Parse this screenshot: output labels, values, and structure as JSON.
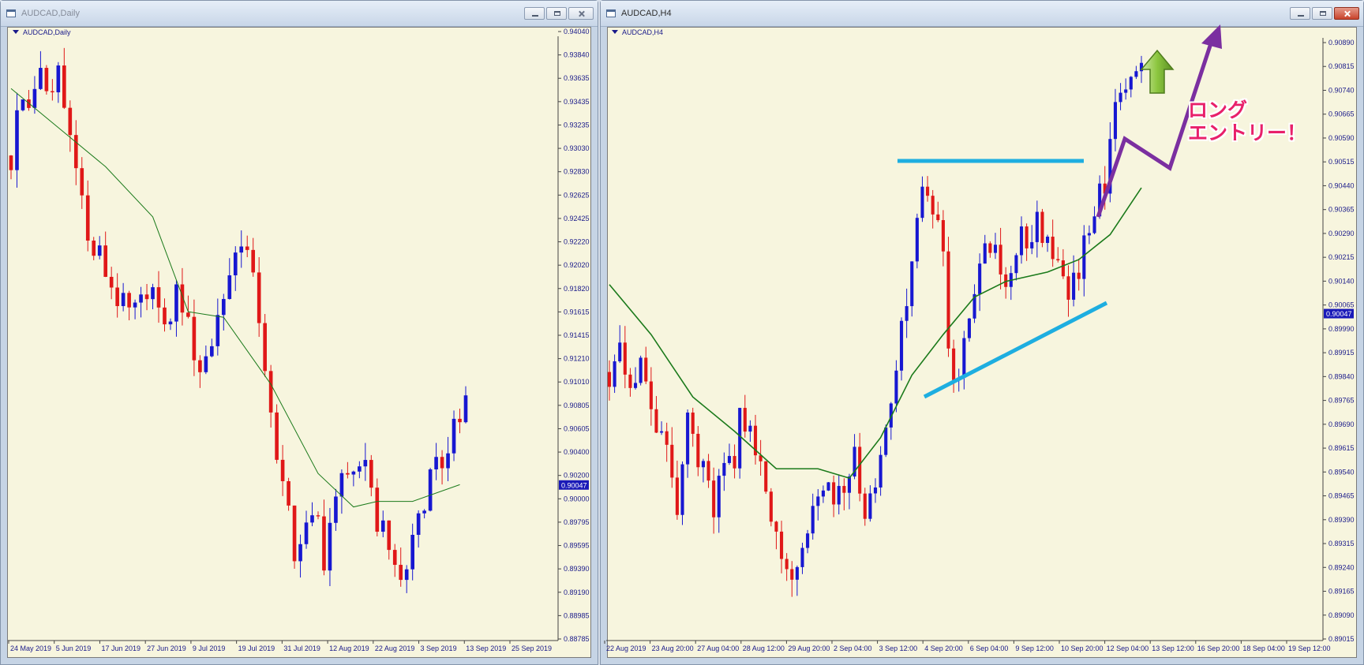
{
  "windows": [
    {
      "id": "left",
      "title": "AUDCAD,Daily",
      "chart_label": "AUDCAD,Daily",
      "active": false
    },
    {
      "id": "right",
      "title": "AUDCAD,H4",
      "chart_label": "AUDCAD,H4",
      "active": true
    }
  ],
  "annotation": {
    "line1": "ロング",
    "line2": "エントリー！"
  },
  "colors": {
    "bull": "#1717d1",
    "bear": "#e01818",
    "ma": "#1b7a1b",
    "trendline": "#1eaee0",
    "arrow": "#7b2fa0",
    "price_tag": "#1a1ab8"
  },
  "icons": {
    "window": "chart-window-icon",
    "minimize": "minimize-icon",
    "maximize": "maximize-icon",
    "close": "close-icon",
    "up": "green-up-arrow-icon"
  },
  "chart_data": [
    {
      "type": "candlestick",
      "symbol": "AUDCAD",
      "timeframe": "Daily",
      "ylim": [
        0.8878,
        0.9404
      ],
      "y_ticks": [
        "0.94040",
        "0.93840",
        "0.93635",
        "0.93435",
        "0.93235",
        "0.93030",
        "0.92830",
        "0.92625",
        "0.92425",
        "0.92220",
        "0.92020",
        "0.91820",
        "0.91615",
        "0.91415",
        "0.91210",
        "0.91010",
        "0.90805",
        "0.90605",
        "0.90400",
        "0.90200",
        "0.90000",
        "0.89795",
        "0.89595",
        "0.89390",
        "0.89190",
        "0.88985",
        "0.88785"
      ],
      "current_price": "0.90047",
      "x_labels": [
        "24 May 2019",
        "5 Jun 2019",
        "17 Jun 2019",
        "27 Jun 2019",
        "9 Jul 2019",
        "19 Jul 2019",
        "31 Jul 2019",
        "12 Aug 2019",
        "22 Aug 2019",
        "3 Sep 2019",
        "13 Sep 2019",
        "25 Sep 2019"
      ],
      "anchors": [
        0.93,
        0.934,
        0.936,
        0.9345,
        0.9378,
        0.935,
        0.9382,
        0.9345,
        0.931,
        0.928,
        0.924,
        0.9225,
        0.9205,
        0.919,
        0.9175,
        0.9165,
        0.915,
        0.917,
        0.9185,
        0.917,
        0.9158,
        0.915,
        0.9175,
        0.9162,
        0.9138,
        0.9108,
        0.9105,
        0.9135,
        0.9172,
        0.9185,
        0.9208,
        0.923,
        0.921,
        0.9165,
        0.911,
        0.906,
        0.9025,
        0.899,
        0.893,
        0.896,
        0.8975,
        0.899,
        0.894,
        0.8985,
        0.9,
        0.902,
        0.901,
        0.9025,
        0.901,
        0.8975,
        0.896,
        0.895,
        0.8925,
        0.8935,
        0.896,
        0.899,
        0.9,
        0.9025,
        0.9015,
        0.9045,
        0.906,
        0.9085
      ],
      "ma": [
        [
          0,
          0.936
        ],
        [
          8,
          0.9325
        ],
        [
          16,
          0.929
        ],
        [
          24,
          0.9245
        ],
        [
          30,
          0.916
        ],
        [
          36,
          0.9155
        ],
        [
          44,
          0.9095
        ],
        [
          52,
          0.9015
        ],
        [
          58,
          0.8985
        ],
        [
          62,
          0.899
        ],
        [
          68,
          0.899
        ],
        [
          76,
          0.9005
        ]
      ]
    },
    {
      "type": "candlestick",
      "symbol": "AUDCAD",
      "timeframe": "H4",
      "ylim": [
        0.8901,
        0.9092
      ],
      "y_ticks": [
        "0.90890",
        "0.90815",
        "0.90740",
        "0.90665",
        "0.90590",
        "0.90515",
        "0.90440",
        "0.90365",
        "0.90290",
        "0.90215",
        "0.90140",
        "0.90065",
        "0.89990",
        "0.89915",
        "0.89840",
        "0.89765",
        "0.89690",
        "0.89615",
        "0.89540",
        "0.89465",
        "0.89390",
        "0.89315",
        "0.89240",
        "0.89165",
        "0.89090",
        "0.89015"
      ],
      "current_price": "0.90047",
      "x_labels": [
        "22 Aug 2019",
        "23 Aug 20:00",
        "27 Aug 04:00",
        "28 Aug 12:00",
        "29 Aug 20:00",
        "2 Sep 04:00",
        "3 Sep 12:00",
        "4 Sep 20:00",
        "6 Sep 04:00",
        "9 Sep 12:00",
        "10 Sep 20:00",
        "12 Sep 04:00",
        "13 Sep 12:00",
        "16 Sep 20:00",
        "18 Sep 04:00",
        "19 Sep 12:00"
      ],
      "anchors": [
        0.8986,
        0.8995,
        0.8985,
        0.8982,
        0.899,
        0.8972,
        0.8965,
        0.8955,
        0.8942,
        0.8972,
        0.8955,
        0.896,
        0.8942,
        0.8962,
        0.8952,
        0.8972,
        0.8965,
        0.896,
        0.895,
        0.8935,
        0.8922,
        0.8915,
        0.8925,
        0.894,
        0.8945,
        0.8955,
        0.8945,
        0.8952,
        0.896,
        0.8942,
        0.8945,
        0.896,
        0.897,
        0.899,
        0.901,
        0.903,
        0.9045,
        0.904,
        0.9035,
        0.899,
        0.8985,
        0.9,
        0.9015,
        0.9022,
        0.903,
        0.9015,
        0.902,
        0.9032,
        0.902,
        0.9035,
        0.903,
        0.9024,
        0.9016,
        0.9012,
        0.9022,
        0.903,
        0.904,
        0.9048,
        0.907,
        0.9082,
        0.9078,
        0.9085
      ],
      "ma": [
        [
          0,
          0.9014
        ],
        [
          8,
          0.8998
        ],
        [
          16,
          0.8978
        ],
        [
          24,
          0.8967
        ],
        [
          32,
          0.8955
        ],
        [
          40,
          0.8955
        ],
        [
          46,
          0.8952
        ],
        [
          52,
          0.8965
        ],
        [
          58,
          0.8985
        ],
        [
          64,
          0.8998
        ],
        [
          70,
          0.901
        ],
        [
          76,
          0.9015
        ],
        [
          84,
          0.9018
        ],
        [
          90,
          0.9022
        ],
        [
          96,
          0.903
        ],
        [
          102,
          0.9045
        ]
      ],
      "drawings": [
        {
          "kind": "horizontal-line",
          "color": "trendline"
        },
        {
          "kind": "rising-trendline",
          "color": "trendline"
        },
        {
          "kind": "arrow",
          "color": "arrow"
        }
      ]
    }
  ]
}
